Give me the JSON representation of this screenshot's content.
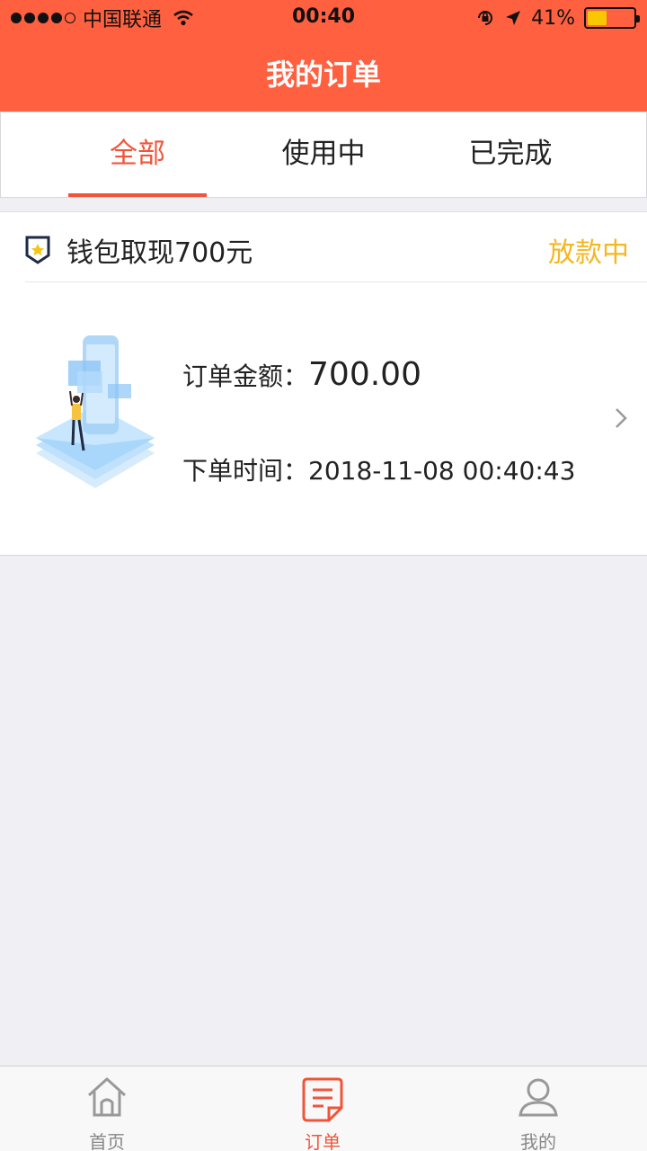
{
  "status_bar": {
    "carrier": "中国联通",
    "time": "00:40",
    "battery_text": "41%",
    "battery_level": 0.41
  },
  "nav": {
    "title": "我的订单"
  },
  "tabs": [
    {
      "label": "全部",
      "active": true
    },
    {
      "label": "使用中",
      "active": false
    },
    {
      "label": "已完成",
      "active": false
    }
  ],
  "order": {
    "title": "钱包取现700元",
    "status": "放款中",
    "status_color": "#f5b720",
    "amount_label": "订单金额：",
    "amount_value": "700.00",
    "time_label": "下单时间：",
    "time_value": "2018-11-08 00:40:43"
  },
  "bottom_nav": [
    {
      "label": "首页",
      "icon": "home-icon",
      "active": false
    },
    {
      "label": "订单",
      "icon": "order-icon",
      "active": true
    },
    {
      "label": "我的",
      "icon": "profile-icon",
      "active": false
    }
  ],
  "colors": {
    "brand": "#ff6040",
    "accent": "#f0553a",
    "background": "#efeff4"
  }
}
